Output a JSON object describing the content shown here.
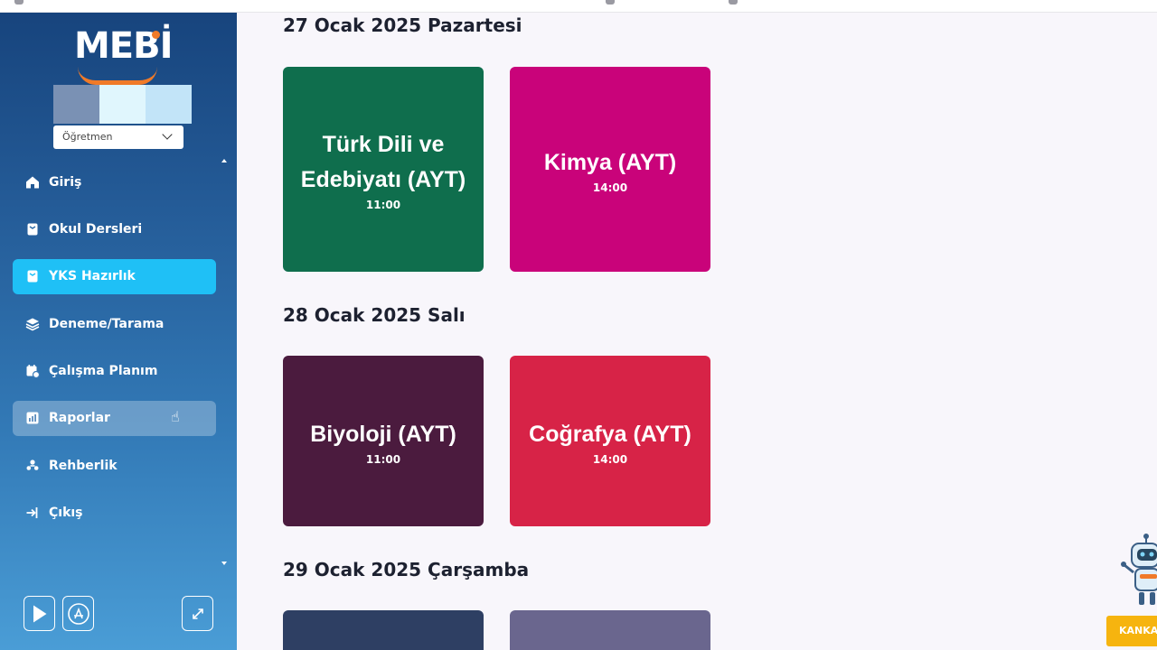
{
  "brand": {
    "name": "MEBİ"
  },
  "user": {
    "role_select_value": "Öğretmen"
  },
  "sidebar": {
    "items": [
      {
        "label": "Giriş",
        "icon": "home-icon"
      },
      {
        "label": "Okul Dersleri",
        "icon": "book-icon"
      },
      {
        "label": "YKS Hazırlık",
        "icon": "book-icon"
      },
      {
        "label": "Deneme/Tarama",
        "icon": "layers-icon"
      },
      {
        "label": "Çalışma Planım",
        "icon": "calendar-gear-icon"
      },
      {
        "label": "Raporlar",
        "icon": "report-chart-icon"
      },
      {
        "label": "Rehberlik",
        "icon": "people-icon"
      },
      {
        "label": "Çıkış",
        "icon": "logout-icon"
      }
    ],
    "active_item": "YKS Hazırlık",
    "hovered_item": "Raporlar"
  },
  "schedule": {
    "days": [
      {
        "title": "27 Ocak 2025 Pazartesi",
        "exams": [
          {
            "subject": "Türk Dili ve Edebiyatı (AYT)",
            "time": "11:00",
            "color": "#0f6e4d"
          },
          {
            "subject": "Kimya (AYT)",
            "time": "14:00",
            "color": "#c9037a"
          }
        ]
      },
      {
        "title": "28 Ocak 2025 Salı",
        "exams": [
          {
            "subject": "Biyoloji (AYT)",
            "time": "11:00",
            "color": "#4b1b3e"
          },
          {
            "subject": "Coğrafya (AYT)",
            "time": "14:00",
            "color": "#d72347"
          }
        ]
      },
      {
        "title": "29 Ocak 2025 Çarşamba",
        "exams": [
          {
            "color": "#2e3f63"
          },
          {
            "color": "#6a668e"
          }
        ]
      }
    ]
  },
  "assistant": {
    "button_label": "KANKA'"
  },
  "colors": {
    "accent_active": "#1fc0f6",
    "brand_orange": "#f07a28",
    "assistant_yellow": "#f6b40f"
  }
}
